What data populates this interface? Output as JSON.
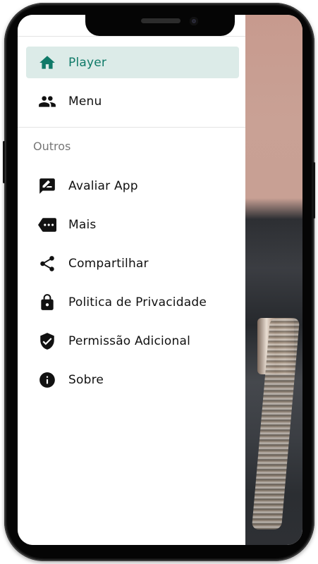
{
  "drawer": {
    "main_items": [
      {
        "label": "Player",
        "icon": "home-icon",
        "active": true
      },
      {
        "label": "Menu",
        "icon": "group-icon",
        "active": false
      }
    ],
    "section_title": "Outros",
    "other_items": [
      {
        "label": "Avaliar App",
        "icon": "rate-review-icon"
      },
      {
        "label": "Mais",
        "icon": "more-tag-icon"
      },
      {
        "label": "Compartilhar",
        "icon": "share-icon"
      },
      {
        "label": "Politica de Privacidade",
        "icon": "lock-icon"
      },
      {
        "label": "Permissão Adicional",
        "icon": "verified-shield-icon"
      },
      {
        "label": "Sobre",
        "icon": "info-icon"
      }
    ]
  },
  "colors": {
    "accent": "#0f7a68",
    "active_background": "#dcebe8",
    "icon": "#111111"
  }
}
